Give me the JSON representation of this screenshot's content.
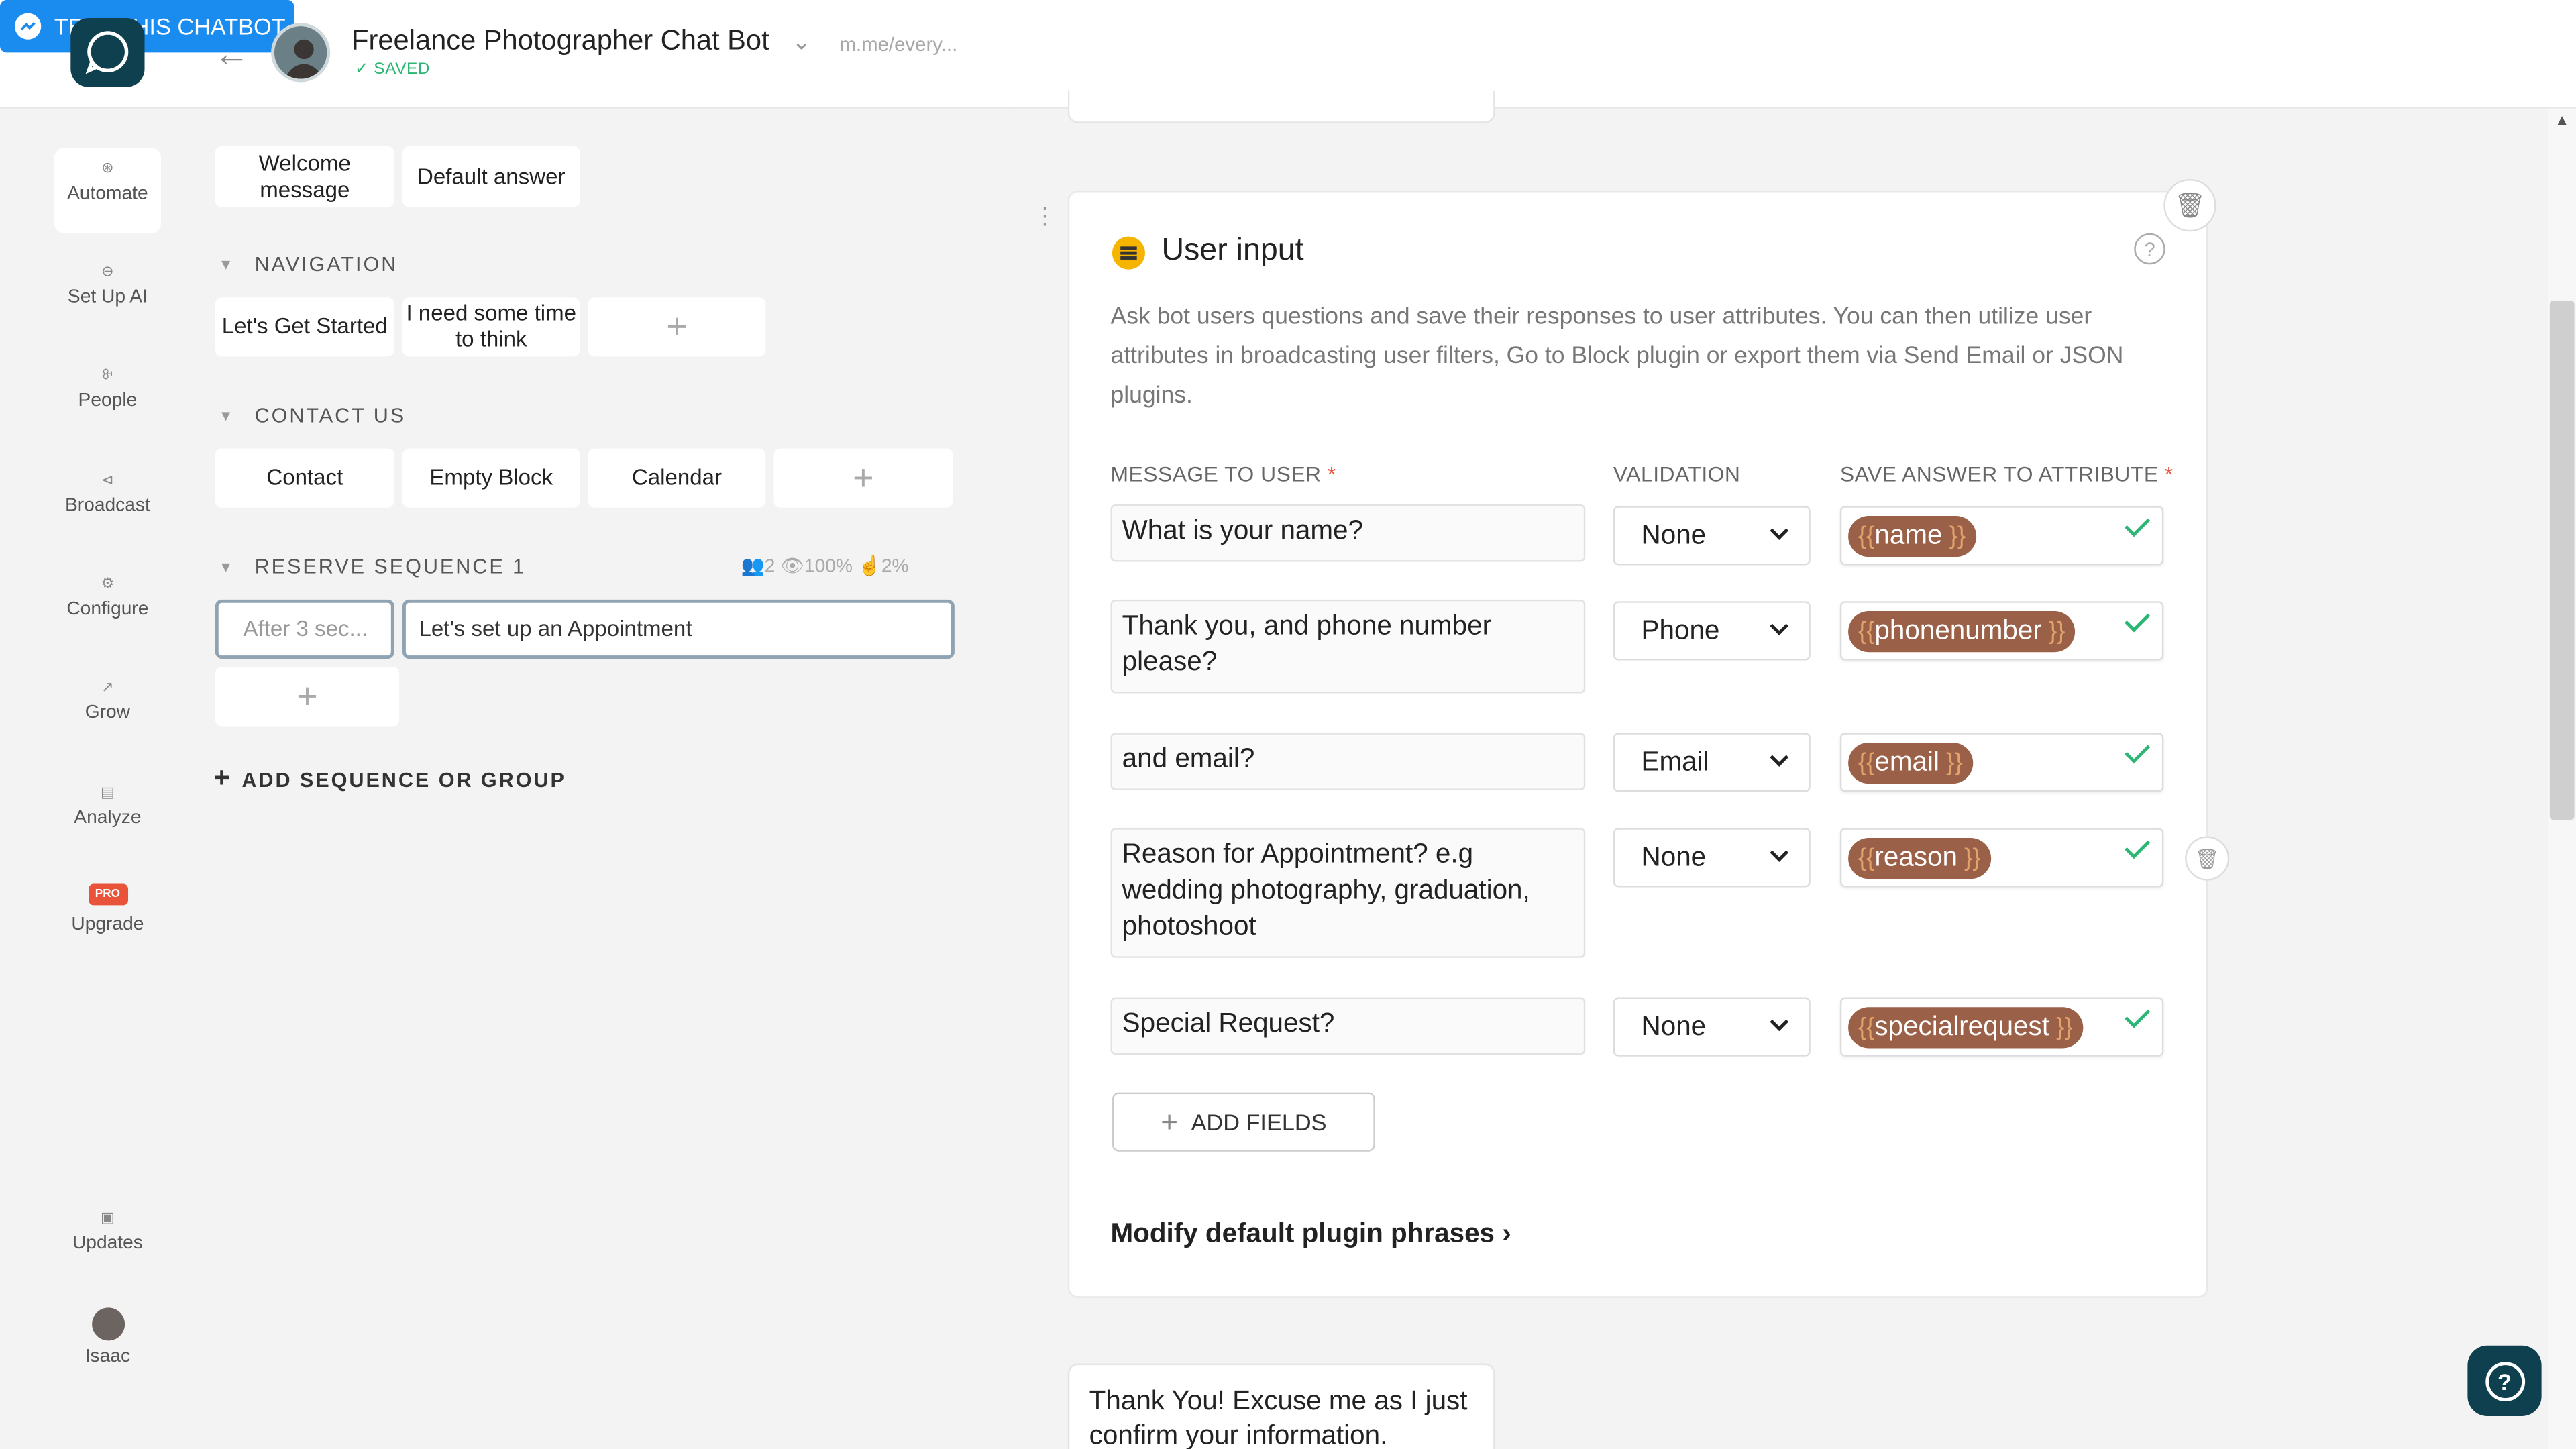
{
  "header": {
    "bot_title": "Freelance Photographer Chat Bot",
    "saved_status": "SAVED",
    "bot_link": "m.me/every...",
    "test_button": "TEST THIS CHATBOT"
  },
  "rail": {
    "items": [
      {
        "label": "Automate"
      },
      {
        "label": "Set Up AI"
      },
      {
        "label": "People"
      },
      {
        "label": "Broadcast"
      },
      {
        "label": "Configure"
      },
      {
        "label": "Grow"
      },
      {
        "label": "Analyze"
      },
      {
        "label": "Upgrade",
        "badge": "PRO"
      },
      {
        "label": "Updates"
      },
      {
        "label": "Isaac"
      }
    ]
  },
  "blocks": {
    "top": [
      "Welcome message",
      "Default answer"
    ],
    "navigation": {
      "title": "NAVIGATION",
      "items": [
        "Let's Get Started",
        "I need some time to think"
      ]
    },
    "contact": {
      "title": "CONTACT US",
      "items": [
        "Contact",
        "Empty Block",
        "Calendar"
      ]
    },
    "sequence": {
      "title": "RESERVE SEQUENCE 1",
      "stats": {
        "users": "2",
        "open_rate": "100%",
        "click_rate": "2%"
      },
      "delay": "After 3 sec...",
      "block": "Let's set up an Appointment"
    },
    "add_sequence": "ADD SEQUENCE OR GROUP"
  },
  "plugin": {
    "title": "User input",
    "description": "Ask bot users questions and save their responses to user attributes. You can then utilize user attributes in broadcasting user filters, Go to Block plugin or export them via Send Email or JSON plugins.",
    "columns": {
      "message": "MESSAGE TO USER",
      "validation": "VALIDATION",
      "attribute": "SAVE ANSWER TO ATTRIBUTE"
    },
    "rows": [
      {
        "message": "What is your name?",
        "validation": "None",
        "attribute": "name"
      },
      {
        "message": "Thank you, and phone number please?",
        "validation": "Phone",
        "attribute": "phonenumber"
      },
      {
        "message": "and email?",
        "validation": "Email",
        "attribute": "email"
      },
      {
        "message": "Reason for Appointment? e.g wedding photography, graduation, photoshoot",
        "validation": "None",
        "attribute": "reason"
      },
      {
        "message": "Special Request?",
        "validation": "None",
        "attribute": "specialrequest"
      }
    ],
    "add_fields": "ADD FIELDS",
    "modify_phrases": "Modify default plugin phrases"
  },
  "next_card_text": "Thank You! Excuse me as I just confirm your information.",
  "colors": {
    "accent": "#1a8cf0",
    "brand": "#0f4050",
    "chip": "#9b6048",
    "success": "#2bb673",
    "pro": "#e8533a"
  }
}
